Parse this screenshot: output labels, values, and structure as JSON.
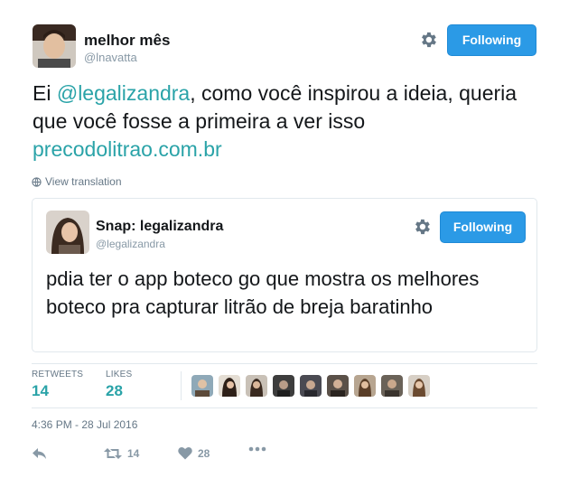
{
  "author": {
    "name": "melhor mês",
    "handle": "@lnavatta",
    "follow_label": "Following"
  },
  "tweet": {
    "text_prefix": "Ei ",
    "mention": "@legalizandra",
    "text_rest": ", como você inspirou a ideia, queria que você fosse a primeira a ver isso",
    "link": "precodolitrao.com.br",
    "translate_label": "View translation"
  },
  "quoted": {
    "name": "Snap: legalizandra",
    "handle": "@legalizandra",
    "follow_label": "Following",
    "text": "pdia ter o app boteco go que mostra os melhores boteco pra capturar litrão de breja baratinho"
  },
  "stats": {
    "retweets_label": "RETWEETS",
    "retweets_value": "14",
    "likes_label": "LIKES",
    "likes_value": "28"
  },
  "timestamp": "4:36 PM - 28 Jul 2016",
  "actions": {
    "retweet_count": "14",
    "like_count": "28"
  },
  "colors": {
    "accent": "#2aa3a8",
    "button": "#2b9ae6",
    "muted": "#8899a6"
  },
  "icons": [
    "gear-icon",
    "globe-icon",
    "reply-icon",
    "retweet-icon",
    "heart-icon",
    "more-icon"
  ]
}
